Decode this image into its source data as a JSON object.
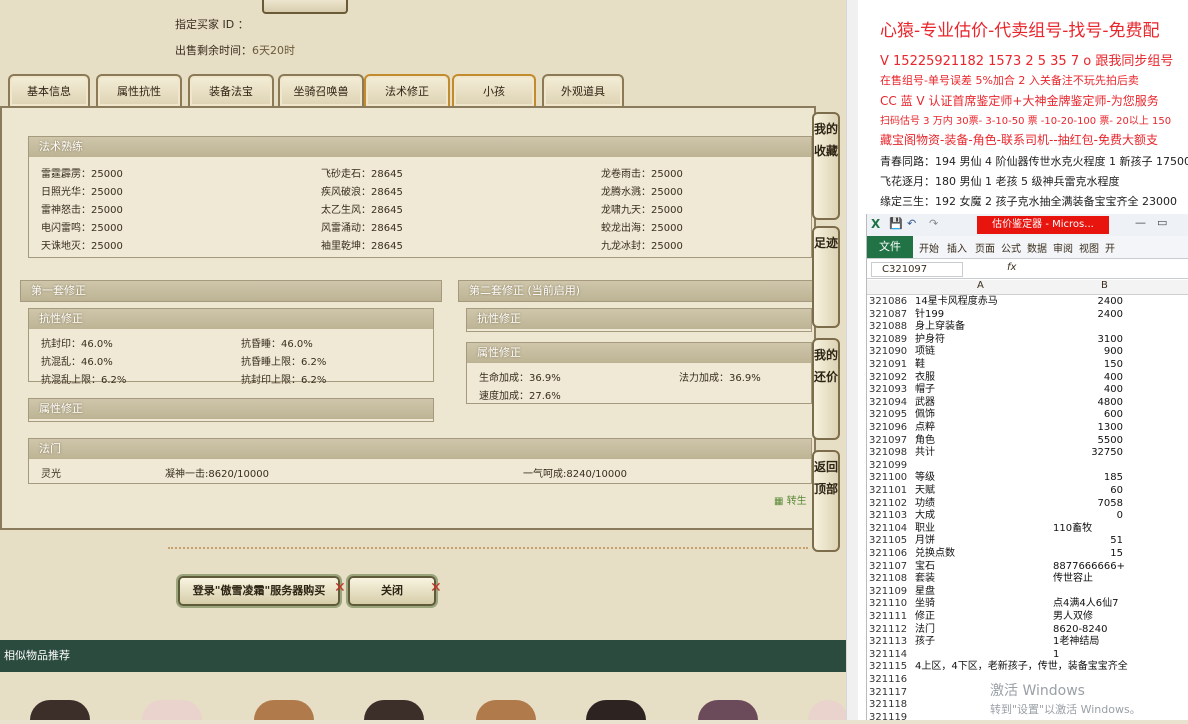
{
  "top_info": {
    "buyer_label": "指定买家 ID ：",
    "remaining_label": "出售剩余时间：",
    "remaining_value": "6天20时"
  },
  "tabs": [
    {
      "label": "基本信息"
    },
    {
      "label": "属性抗性"
    },
    {
      "label": "装备法宝"
    },
    {
      "label": "坐骑召唤兽"
    },
    {
      "label": "法术修正"
    },
    {
      "label": "小孩"
    },
    {
      "label": "外观道具"
    }
  ],
  "skill_section": {
    "title": "法术熟练",
    "col1": [
      "雷霆霹雳：25000",
      "日照光华：25000",
      "雷神怒击：25000",
      "电闪雷鸣：25000",
      "天诛地灭：25000"
    ],
    "col2": [
      "飞砂走石：28645",
      "疾风破浪：28645",
      "太乙生风：28645",
      "风雷涌动：28645",
      "袖里乾坤：28645"
    ],
    "col3": [
      "龙卷雨击：25000",
      "龙腾水溅：25000",
      "龙啸九天：25000",
      "蛟龙出海：25000",
      "九龙冰封：25000"
    ]
  },
  "set1": {
    "title": "第一套修正",
    "resist_title": "抗性修正",
    "resist_col1": [
      "抗封印：46.0%",
      "抗混乱：46.0%",
      "抗混乱上限：6.2%"
    ],
    "resist_col2": [
      "抗昏睡：46.0%",
      "抗昏睡上限：6.2%",
      "抗封印上限：6.2%"
    ],
    "attr_title": "属性修正"
  },
  "set2": {
    "title": "第二套修正 (当前启用)",
    "resist_title": "抗性修正",
    "attr_title": "属性修正",
    "attr_col1": [
      "生命加成：36.9%",
      "速度加成：27.6%"
    ],
    "attr_col2": [
      "法力加成：36.9%"
    ]
  },
  "fa_men": {
    "title": "法门",
    "items": [
      "灵光",
      "凝神一击:8620/10000",
      "一气呵成:8240/10000"
    ]
  },
  "side_buttons": [
    "我的收藏",
    "足迹",
    "我的还价",
    "返回顶部"
  ],
  "link_fragment": "转生",
  "buttons": {
    "buy": "登录\"傲雪凌霜\"服务器购买",
    "close": "关闭"
  },
  "recommend_title": "相似物品推荐",
  "ad_lines": [
    "心猿-专业估价-代卖组号-找号-免费配",
    "V 15225921182   1573 2 5 35 7 o 跟我同步组号",
    "在售组号-单号误差 5%加合 2 入关备注不玩先拍后卖",
    "CC 蓝 V 认证首席鉴定师+大神金牌鉴定师-为您服务",
    "扫码估号 3 万内 30票- 3-10-50 票  -10-20-100 票- 20以上 150",
    "藏宝阁物资-装备-角色-联系司机--抽红包-免费大额支"
  ],
  "info_lines": [
    "青春同路：194 男仙 4 阶仙器传世水克火程度 1 新孩子 17500",
    "飞花逐月：180 男仙 1 老孩 5 级神兵雷克水程度",
    "缘定三生：192 女魔 2 孩子克水抽全满装备宝宝齐全 23000"
  ],
  "excel": {
    "window_title": "估价鉴定器 - Micros...",
    "ribbon_tabs": [
      "文件",
      "开始",
      "插入",
      "页面",
      "公式",
      "数据",
      "审阅",
      "视图",
      "开"
    ],
    "name_box": "C321097",
    "fx": "fx",
    "col_headers": [
      "A",
      "B"
    ],
    "rows": [
      {
        "n": "321086",
        "a": "14星卡风程度赤马",
        "b": "2400"
      },
      {
        "n": "321087",
        "a": "针199",
        "b": "2400"
      },
      {
        "n": "321088",
        "a": "身上穿装备",
        "b": ""
      },
      {
        "n": "321089",
        "a": "护身符",
        "b": "3100"
      },
      {
        "n": "321090",
        "a": "项链",
        "b": "900"
      },
      {
        "n": "321091",
        "a": "鞋",
        "b": "150"
      },
      {
        "n": "321092",
        "a": "衣服",
        "b": "400"
      },
      {
        "n": "321093",
        "a": "帽子",
        "b": "400"
      },
      {
        "n": "321094",
        "a": "武器",
        "b": "4800"
      },
      {
        "n": "321095",
        "a": "佩饰",
        "b": "600"
      },
      {
        "n": "321096",
        "a": "点粹",
        "b": "1300"
      },
      {
        "n": "321097",
        "a": "角色",
        "b": "5500"
      },
      {
        "n": "321098",
        "a": "共计",
        "b": "32750"
      },
      {
        "n": "321099",
        "a": "",
        "b": ""
      },
      {
        "n": "321100",
        "a": "等级",
        "b": "185"
      },
      {
        "n": "321101",
        "a": "天赋",
        "b": "60"
      },
      {
        "n": "321102",
        "a": "功绩",
        "b": "7058"
      },
      {
        "n": "321103",
        "a": "大成",
        "b": "0"
      },
      {
        "n": "321104",
        "a": "职业",
        "bl": "110畜牧"
      },
      {
        "n": "321105",
        "a": "月饼",
        "b": "51"
      },
      {
        "n": "321106",
        "a": "兑换点数",
        "b": "15"
      },
      {
        "n": "321107",
        "a": "宝石",
        "bl": "8877666666+"
      },
      {
        "n": "321108",
        "a": "套装",
        "bl": "传世容止"
      },
      {
        "n": "321109",
        "a": "星盘",
        "b": ""
      },
      {
        "n": "321110",
        "a": "坐骑",
        "bl": "点4满4人6仙7"
      },
      {
        "n": "321111",
        "a": "修正",
        "bl": "男人双修"
      },
      {
        "n": "321112",
        "a": "法门",
        "bl": "8620-8240"
      },
      {
        "n": "321113",
        "a": "孩子",
        "bl": "1老神结局"
      },
      {
        "n": "321114",
        "a": "",
        "bl": "1"
      },
      {
        "n": "321115",
        "a": "4上区，4下区，老新孩子，传世，装备宝宝齐全",
        "b": ""
      },
      {
        "n": "321116",
        "a": "",
        "b": ""
      },
      {
        "n": "321117",
        "a": "",
        "b": ""
      },
      {
        "n": "321118",
        "a": "",
        "b": ""
      },
      {
        "n": "321119",
        "a": "",
        "b": ""
      }
    ]
  },
  "watermark": {
    "line1": "激活 Windows",
    "line2": "转到\"设置\"以激活 Windows。"
  }
}
